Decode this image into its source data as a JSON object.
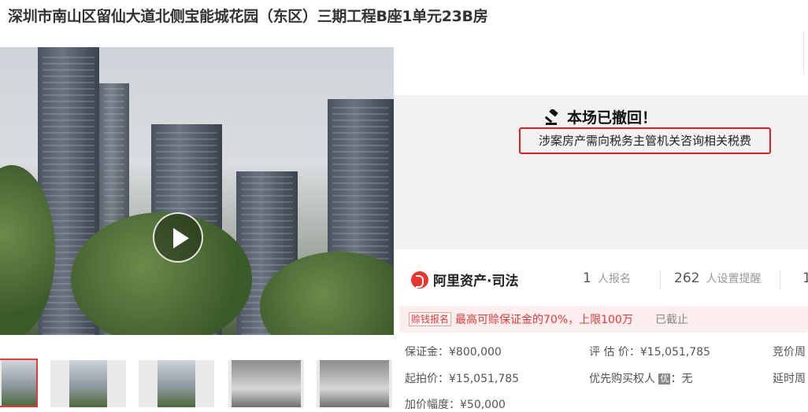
{
  "title": "深圳市南山区留仙大道北侧宝能城花园（东区）三期工程B座1单元23B房",
  "gallery": {
    "main_alt": "buildings-photo",
    "play_icon": "play-icon",
    "thumbnails": [
      "thumb-building-1",
      "thumb-building-2",
      "thumb-building-3",
      "thumb-room-1",
      "thumb-room-2"
    ]
  },
  "status": {
    "icon": "gavel-icon",
    "title": "本场已撤回！",
    "note": "涉案房产需向税务主管机关咨询相关税费"
  },
  "platform": {
    "logo_text": "阿里资产·司法",
    "registrations_num": "1",
    "registrations_label": "人报名",
    "reminders_num": "262",
    "reminders_label": "人设置提醒",
    "third_num": "1"
  },
  "promo": {
    "tag": "赊钱报名",
    "text": "最高可赊保证金的70%，上限100万",
    "deadline": "已截止"
  },
  "details": {
    "deposit": "保证金：¥800,000",
    "appraisal": "评 估 价：¥15,051,785",
    "bid_cycle": "竞价周",
    "start_price": "起拍价：¥15,051,785",
    "priority_prefix": "优先购买权人",
    "priority_badge": "优",
    "priority_value": "：无",
    "delay": "延时周",
    "increment": "加价幅度：¥50,000"
  },
  "colors": {
    "accent_red": "#e4393c",
    "panel_gray": "#f2f2f2"
  }
}
